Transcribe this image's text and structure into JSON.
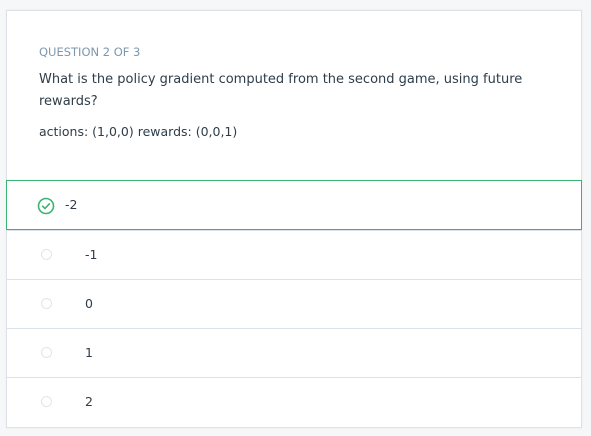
{
  "question": {
    "counter": "QUESTION 2 OF 3",
    "prompt": "What is the policy gradient computed from the second game, using future rewards?",
    "detail": "actions: (1,0,0) rewards: (0,0,1)"
  },
  "options": [
    {
      "label": "-2",
      "selected": true
    },
    {
      "label": "-1",
      "selected": false
    },
    {
      "label": "0",
      "selected": false
    },
    {
      "label": "1",
      "selected": false
    },
    {
      "label": "2",
      "selected": false
    }
  ],
  "colors": {
    "accent": "#3cb371",
    "label": "#7d97ad",
    "text": "#2e3d49",
    "border": "#dbe2e8"
  },
  "icons": {
    "selected": "check-circle-icon",
    "unselected": "radio-icon"
  }
}
